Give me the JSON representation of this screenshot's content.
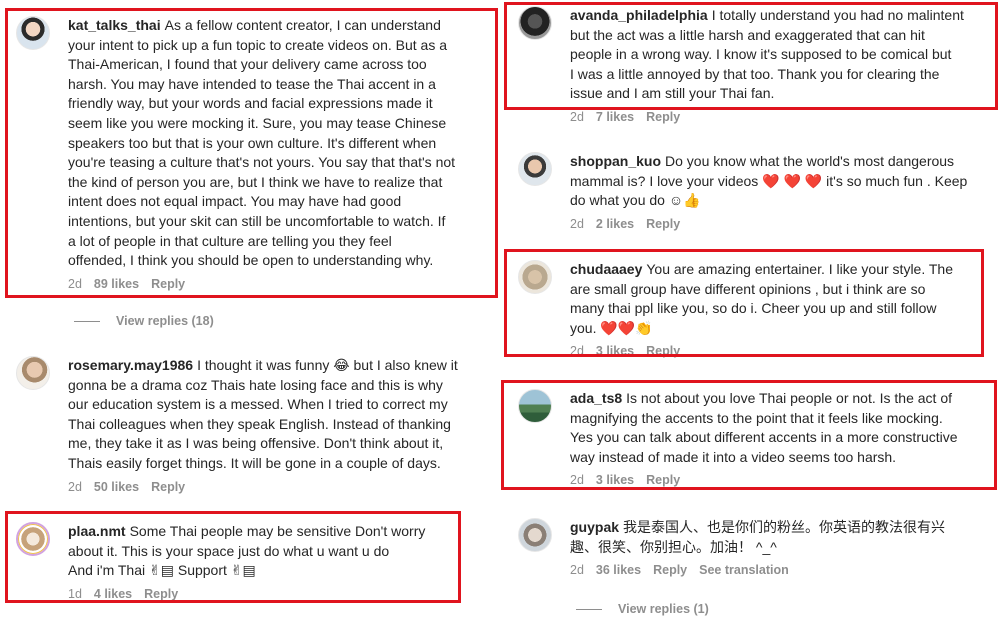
{
  "colors": {
    "highlight": "#e0141e",
    "meta": "#8e8e8e",
    "text": "#262626",
    "heart": "#e0242f"
  },
  "left": {
    "c1": {
      "username": "kat_talks_thai",
      "lines": [
        "As a fellow content creator, I can understand",
        "your intent to pick up a fun topic to create videos on. But as a",
        "Thai-American, I found that your delivery came across too",
        "harsh. You may have intended to tease the Thai accent in a",
        "friendly way, but your words and facial expressions made it",
        "seem like you were mocking it. Sure, you may tease Chinese",
        "speakers too but that is your own culture. It's different when",
        "you're teasing a culture that's not yours. You say that that's not",
        "the kind of person you are, but I think we have to realize that",
        "intent does not equal impact. You may have had good",
        "intentions, but your skit can still be uncomfortable to watch. If",
        "a lot of people in that culture are telling you they feel",
        "offended, I think you should be open to understanding why."
      ],
      "time": "2d",
      "likes": "89 likes",
      "reply": "Reply",
      "view_replies": "View replies (18)"
    },
    "c2": {
      "username": "rosemary.may1986",
      "lines": [
        "I thought it was funny 😂 but I also knew it",
        "gonna be a drama coz Thais hate losing face and this is why",
        "our education system is a messed. When I tried to correct my",
        "Thai colleagues when they speak English. Instead of thanking",
        "me, they take it as I was being offensive. Don't think about it,",
        "Thais easily forget things. It will be gone in a couple of days."
      ],
      "time": "2d",
      "likes": "50 likes",
      "reply": "Reply"
    },
    "c3": {
      "username": "plaa.nmt",
      "lines": [
        "Some Thai people may be sensitive Don't worry",
        "about it. This is your space just do what u want u do",
        "And i'm Thai ✌▤ Support ✌▤"
      ],
      "time": "1d",
      "likes": "4 likes",
      "reply": "Reply"
    }
  },
  "right": {
    "c1": {
      "username": "avanda_philadelphia",
      "lines": [
        "I totally understand you had no malintent",
        "but the act was a little harsh and exaggerated that can hit",
        "people in a wrong way. I know it's supposed to be comical but",
        "I was a little annoyed by that too. Thank you for clearing the",
        "issue and I am still your Thai fan."
      ],
      "time": "2d",
      "likes": "7 likes",
      "reply": "Reply"
    },
    "c2": {
      "username": "shoppan_kuo",
      "lines": [
        "Do you know what the world's most dangerous",
        "mammal is? I love your videos ❤️ ❤️ ❤️  it's so much fun . Keep",
        "do what you do ☺👍"
      ],
      "time": "2d",
      "likes": "2 likes",
      "reply": "Reply"
    },
    "c3": {
      "username": "chudaaaey",
      "lines": [
        "You are amazing entertainer. I like your style. The",
        "are small group have different opinions , but i think are so",
        "many thai ppl like you, so do i. Cheer you up and still follow",
        "you. ❤️❤️👏"
      ],
      "time": "2d",
      "likes": "3 likes",
      "reply": "Reply"
    },
    "c4": {
      "username": "ada_ts8",
      "lines": [
        "Is not about you love Thai people or not. Is the act of",
        "magnifying the accents to the point that it feels like mocking.",
        "Yes you can talk about different accents in a more constructive",
        "way instead of made it into a video seems too harsh."
      ],
      "time": "2d",
      "likes": "3 likes",
      "reply": "Reply"
    },
    "c5": {
      "username": "guypak",
      "lines": [
        "我是泰国人、也是你们的粉丝。你英语的教法很有兴",
        "趣、很笑、你别担心。加油！ ^_^"
      ],
      "time": "2d",
      "likes": "36 likes",
      "reply": "Reply",
      "translate": "See translation",
      "view_replies": "View replies (1)"
    }
  }
}
